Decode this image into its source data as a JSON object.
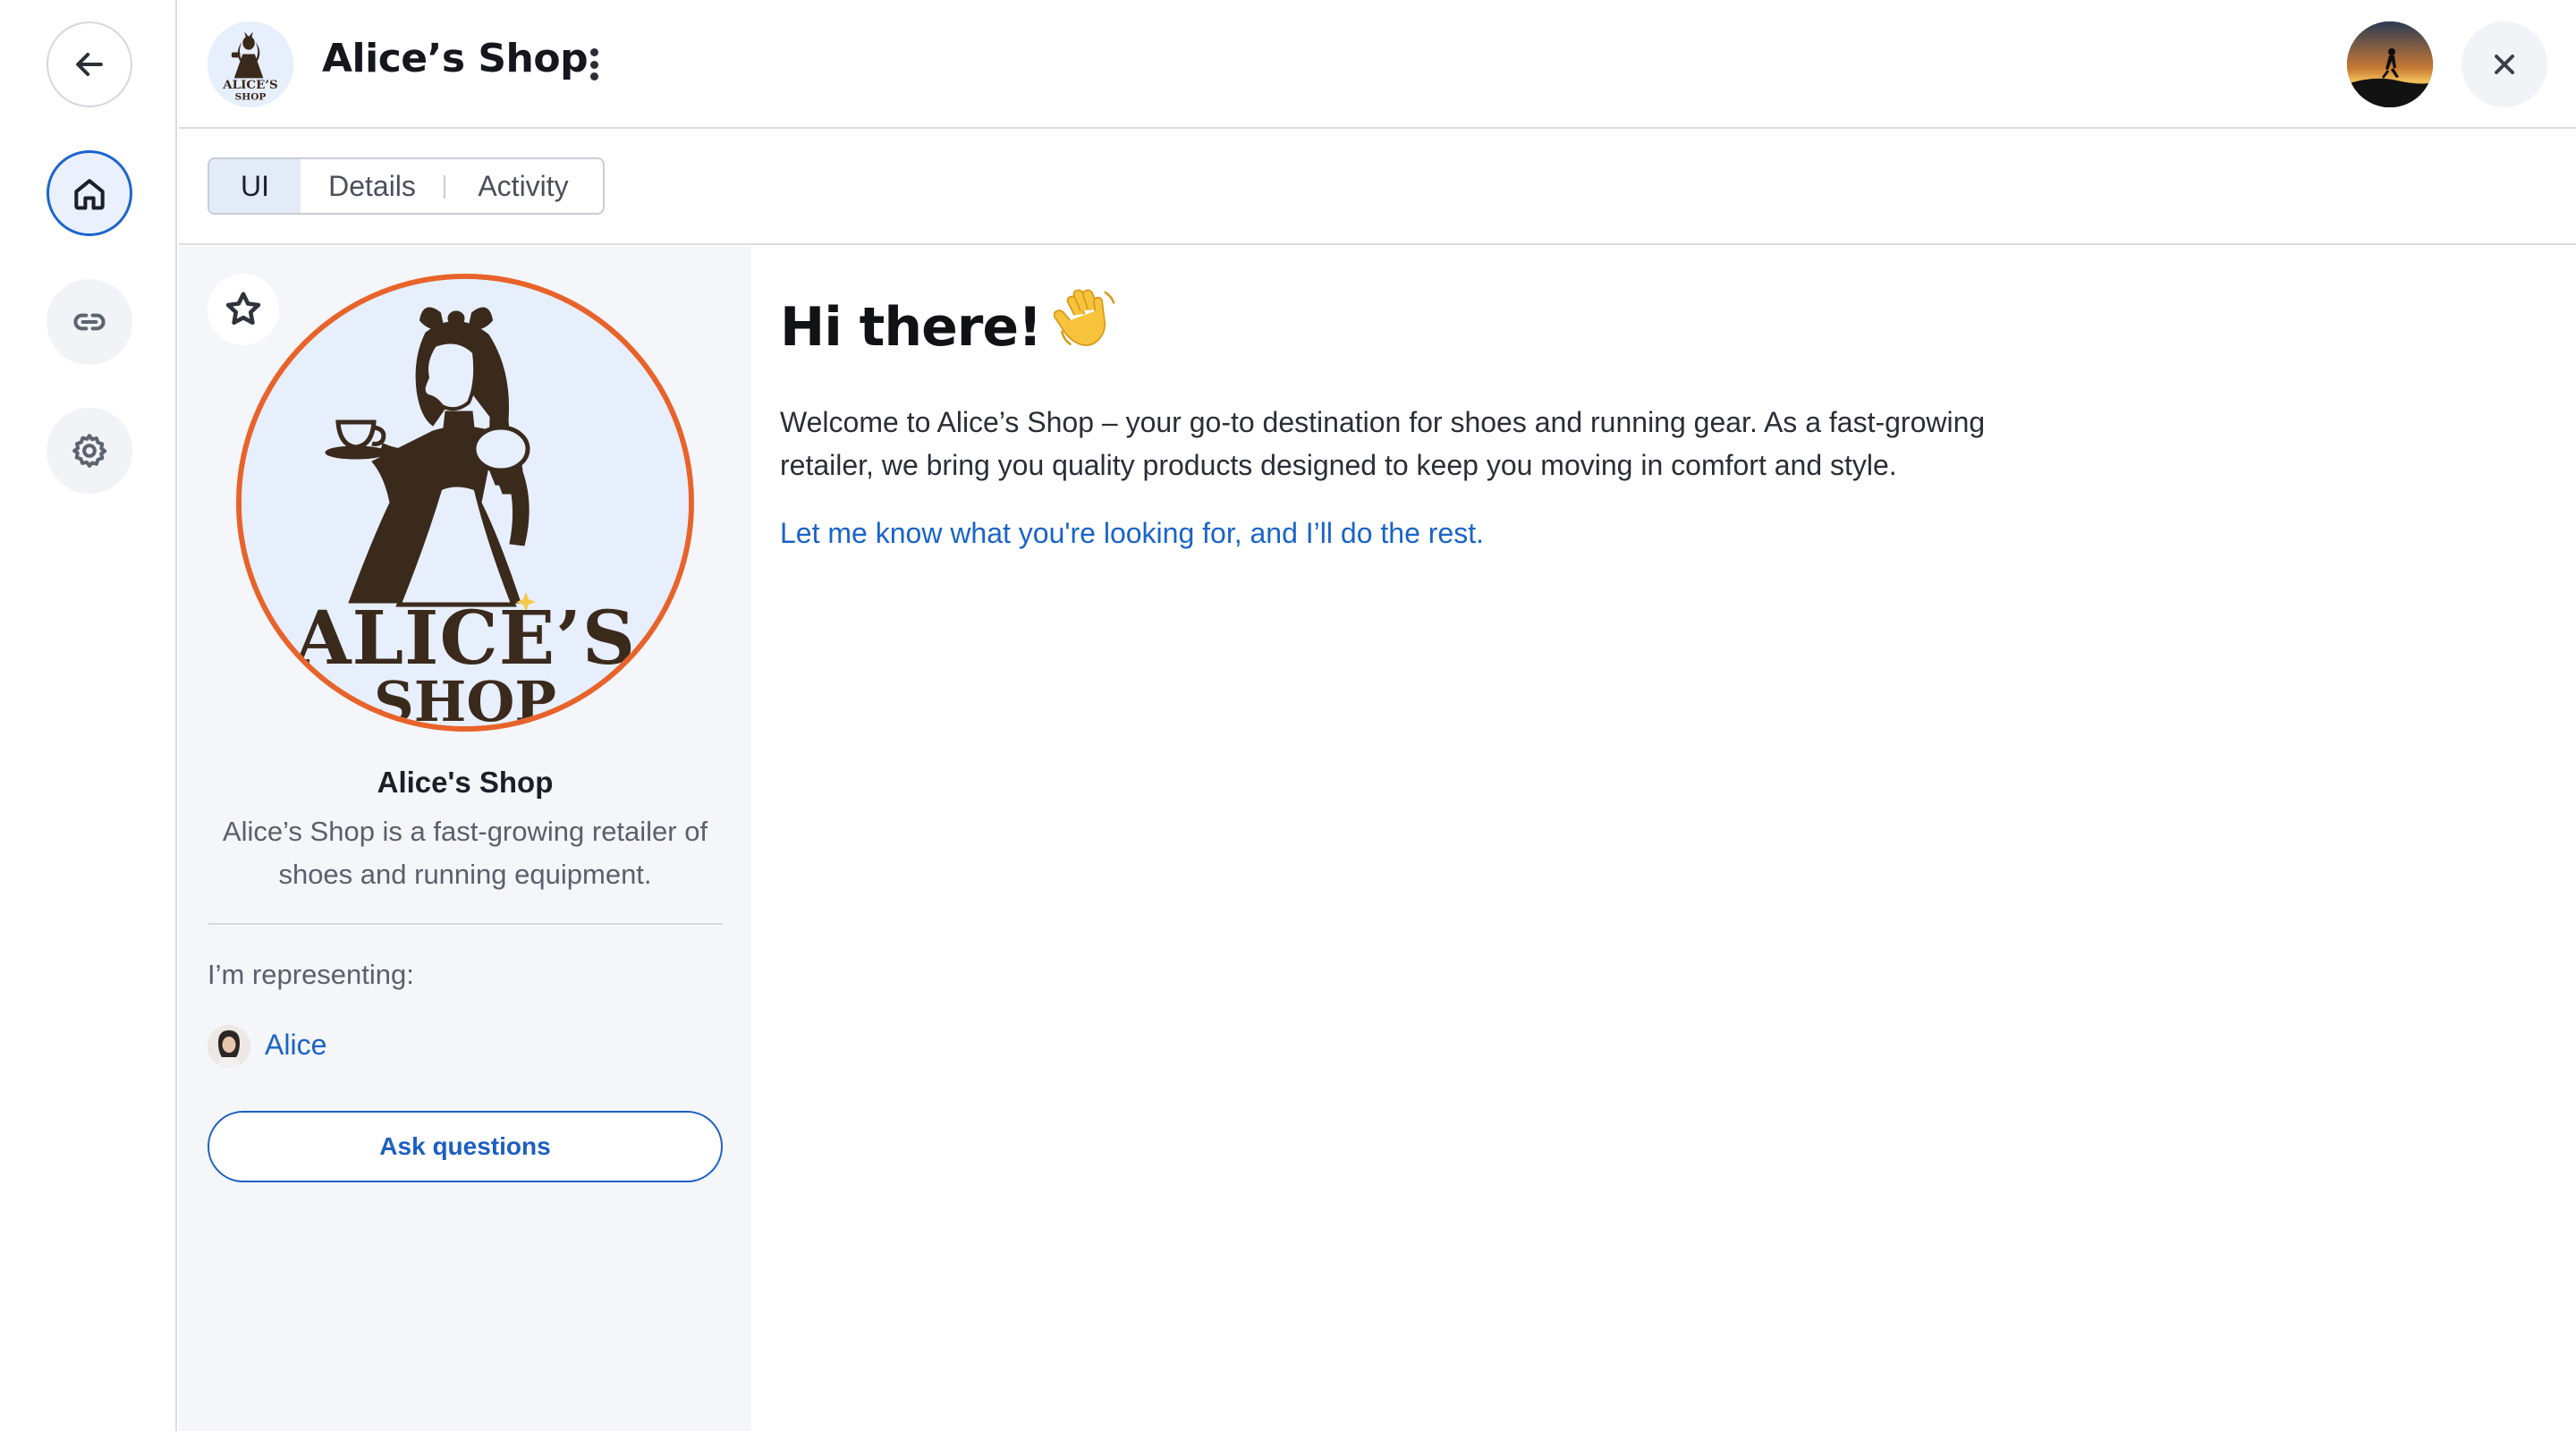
{
  "rail": {
    "back_icon": "arrow-left-icon",
    "home_icon": "home-icon",
    "link_icon": "link-icon",
    "settings_icon": "gear-icon"
  },
  "header": {
    "title": "Alice’s Shop",
    "logo_text_line1": "ALICE’S",
    "logo_text_line2": "SHOP",
    "menu_icon": "kebab-menu-icon",
    "close_icon": "close-icon"
  },
  "tabs": [
    {
      "label": "UI",
      "active": true
    },
    {
      "label": "Details",
      "active": false
    },
    {
      "label": "Activity",
      "active": false
    }
  ],
  "profile": {
    "favorite_icon": "star-icon",
    "logo_text_line1": "ALICE’S",
    "logo_text_line2": "SHOP",
    "name": "Alice's Shop",
    "description": "Alice’s Shop is a fast-growing retailer of shoes and running equipment.",
    "representing_label": "I’m representing:",
    "representative_name": "Alice",
    "ask_button": "Ask questions"
  },
  "main": {
    "greeting": "Hi there!",
    "greeting_emoji": "waving-hand-icon",
    "welcome_text": "Welcome to Alice’s Shop – your go-to destination for shoes and running gear. As a fast-growing retailer, we bring you quality products designed to keep you moving in comfort and style.",
    "cta_text": "Let me know what you're looking for, and I’ll do the rest."
  },
  "colors": {
    "accent_blue": "#1c64d0",
    "logo_ring": "#e8632a",
    "logo_brown": "#3a2a1c",
    "panel_bg": "#f4f6fa"
  }
}
